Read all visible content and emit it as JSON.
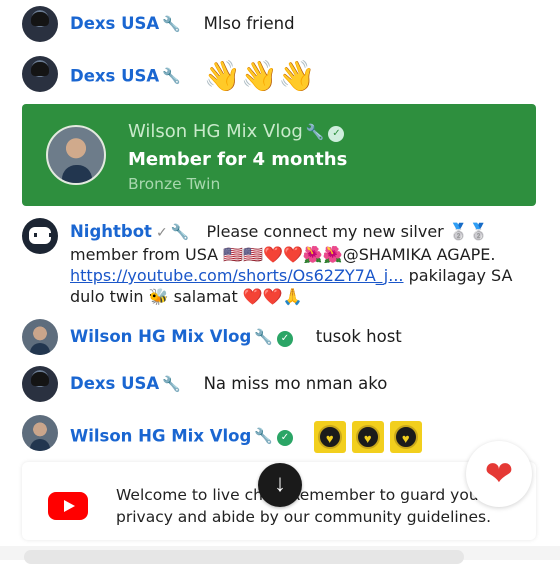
{
  "messages": [
    {
      "author": "Dexs USA",
      "text": "Mlso friend"
    },
    {
      "author": "Dexs USA",
      "emoji": "👋👋👋"
    },
    {
      "author": "Nightbot",
      "text_line1": "Please connect my new silver 🥈🥈",
      "text_line2": "member from USA 🇺🇸🇺🇸❤️❤️🌺🌺@SHAMIKA AGAPE.",
      "link": "https://youtube.com/shorts/Os62ZY7A_j...",
      "text_after_link": " pakilagay SA",
      "text_line4": "dulo twin 🐝 salamat ❤️❤️🙏"
    },
    {
      "author": "Wilson HG Mix Vlog",
      "text": "tusok host"
    },
    {
      "author": "Dexs USA",
      "text": "Na miss mo nman ako"
    },
    {
      "author": "Wilson HG Mix Vlog"
    }
  ],
  "member_card": {
    "name": "Wilson HG Mix Vlog",
    "headline": "Member for 4 months",
    "tier": "Bronze Twin",
    "background": "#2e8f3e"
  },
  "welcome": {
    "text": "Welcome to live chat! Remember to guard your privacy and abide by our community guidelines."
  },
  "icons": {
    "wrench": "🔧",
    "verified": "✓",
    "scroll_down": "↓",
    "heart": "❤"
  },
  "colors": {
    "author_blue": "#1a66d1",
    "youtube_red": "#ff0000"
  }
}
